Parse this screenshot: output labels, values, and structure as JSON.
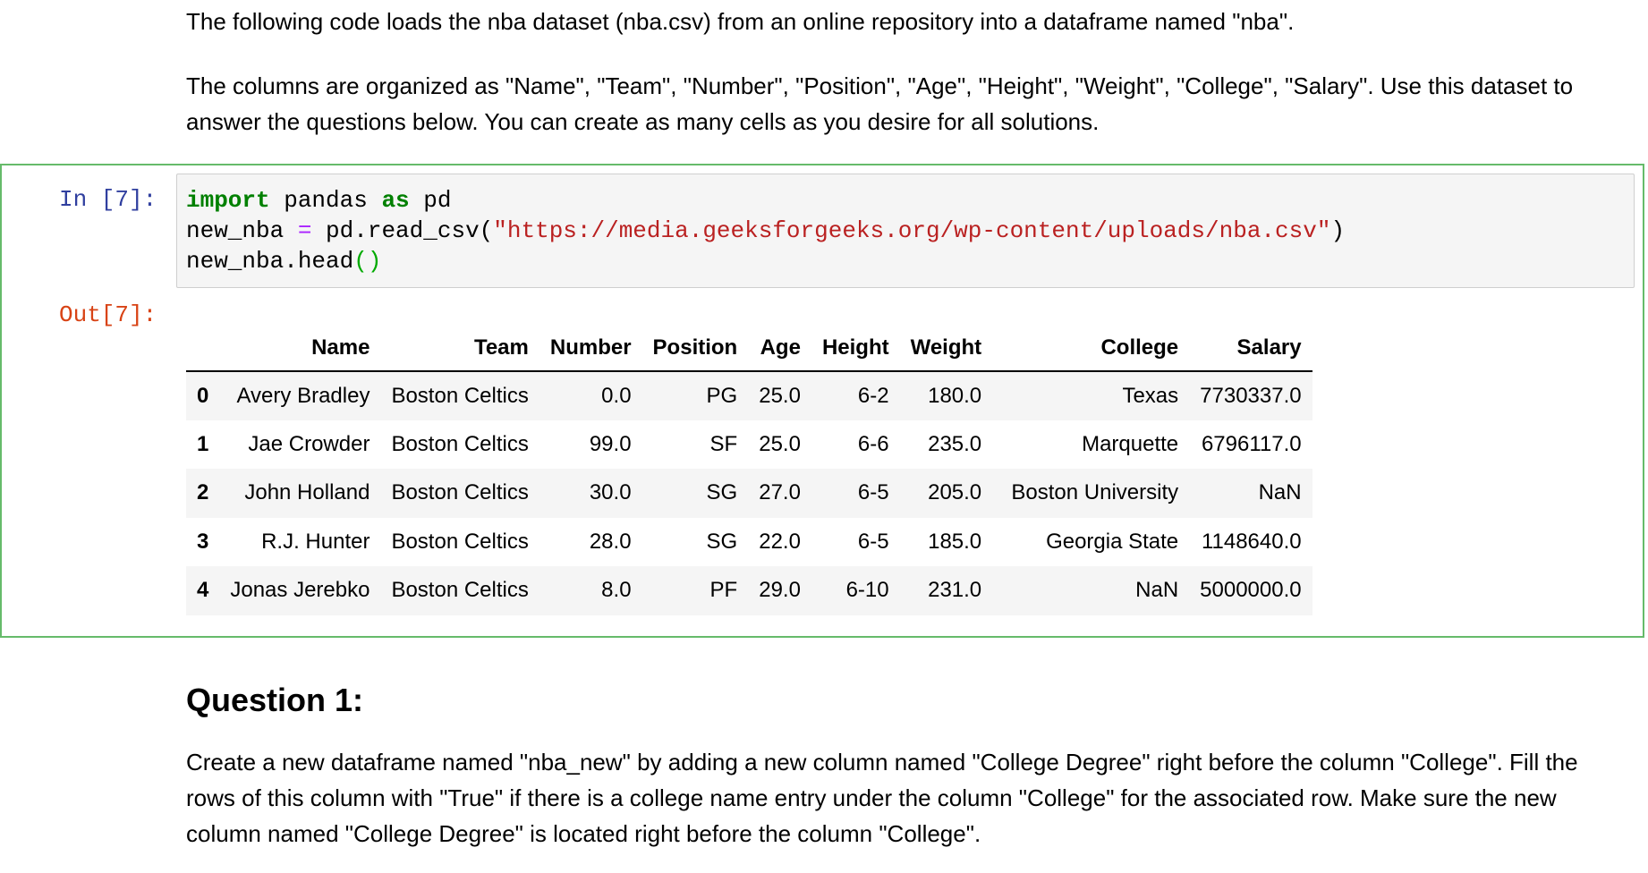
{
  "intro": {
    "line1": "The following code loads the nba dataset (nba.csv) from an online repository into a dataframe named \"nba\".",
    "line2": "The columns are organized as \"Name\", \"Team\", \"Number\", \"Position\", \"Age\", \"Height\", \"Weight\", \"College\", \"Salary\". Use this dataset to answer the questions below. You can create as many cells as you desire for all solutions."
  },
  "cell": {
    "in_prompt": "In [7]:",
    "out_prompt": "Out[7]:",
    "code": {
      "l1_kw1": "import",
      "l1_mid": " pandas ",
      "l1_kw2": "as",
      "l1_end": " pd",
      "l2_a": "new_nba ",
      "l2_op": "=",
      "l2_b": " pd.read_csv(",
      "l2_str": "\"https://media.geeksforgeeks.org/wp-content/uploads/nba.csv\"",
      "l2_c": ")",
      "l3_a": "new_nba.head",
      "l3_par": "()"
    }
  },
  "table": {
    "columns": [
      "Name",
      "Team",
      "Number",
      "Position",
      "Age",
      "Height",
      "Weight",
      "College",
      "Salary"
    ],
    "rows": [
      {
        "index": "0",
        "cells": [
          "Avery Bradley",
          "Boston Celtics",
          "0.0",
          "PG",
          "25.0",
          "6-2",
          "180.0",
          "Texas",
          "7730337.0"
        ]
      },
      {
        "index": "1",
        "cells": [
          "Jae Crowder",
          "Boston Celtics",
          "99.0",
          "SF",
          "25.0",
          "6-6",
          "235.0",
          "Marquette",
          "6796117.0"
        ]
      },
      {
        "index": "2",
        "cells": [
          "John Holland",
          "Boston Celtics",
          "30.0",
          "SG",
          "27.0",
          "6-5",
          "205.0",
          "Boston University",
          "NaN"
        ]
      },
      {
        "index": "3",
        "cells": [
          "R.J. Hunter",
          "Boston Celtics",
          "28.0",
          "SG",
          "22.0",
          "6-5",
          "185.0",
          "Georgia State",
          "1148640.0"
        ]
      },
      {
        "index": "4",
        "cells": [
          "Jonas Jerebko",
          "Boston Celtics",
          "8.0",
          "PF",
          "29.0",
          "6-10",
          "231.0",
          "NaN",
          "5000000.0"
        ]
      }
    ]
  },
  "question1": {
    "title": "Question 1:",
    "text": "Create a new dataframe named \"nba_new\" by adding a new column named \"College Degree\" right before the column \"College\". Fill the rows of this column with \"True\" if there is a college name entry under the column \"College\" for the associated row. Make sure the new column named \"College Degree\" is located right before the column \"College\"."
  }
}
